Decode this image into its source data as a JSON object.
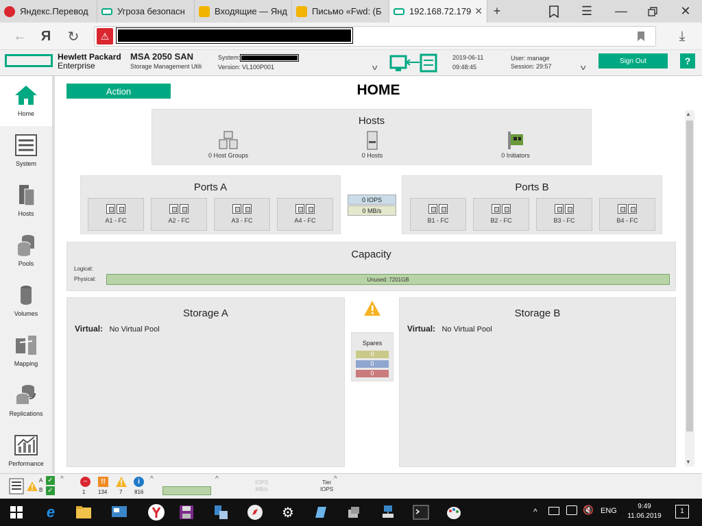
{
  "browser": {
    "tabs": [
      {
        "title": "Яндекс.Перевод",
        "favicon_color": "#d9262f"
      },
      {
        "title": "Угроза безопасн",
        "favicon_color": "#01a982"
      },
      {
        "title": "Входящие — Янд",
        "favicon_color": "#f2b400"
      },
      {
        "title": "Письмо «Fwd: (Б",
        "favicon_color": "#f2b400"
      },
      {
        "title": "192.168.72.179",
        "favicon_color": "#01a982",
        "active": true
      }
    ],
    "new_tab": "+",
    "yandex_letter": "Я"
  },
  "app": {
    "brand_line1": "Hewlett Packard",
    "brand_line2": "Enterprise",
    "product": "MSA 2050 SAN",
    "product_sub": "Storage Management Utili",
    "system_label": "System:",
    "version_label": "Version: VL100P001",
    "date": "2019-06-11",
    "time": "09:48:45",
    "user": "User: manage",
    "session": "Session: 29:57",
    "signout": "Sign Out",
    "help": "?",
    "accent": "#01a982"
  },
  "sidebar": {
    "items": [
      {
        "label": "Home"
      },
      {
        "label": "System"
      },
      {
        "label": "Hosts"
      },
      {
        "label": "Pools"
      },
      {
        "label": "Volumes"
      },
      {
        "label": "Mapping"
      },
      {
        "label": "Replications"
      },
      {
        "label": "Performance"
      }
    ]
  },
  "main": {
    "action": "Action",
    "title": "HOME",
    "hosts": {
      "title": "Hosts",
      "groups": "0 Host Groups",
      "hosts": "0 Hosts",
      "initiators": "0 Initiators"
    },
    "ports_a": {
      "title": "Ports A",
      "ports": [
        "A1 - FC",
        "A2 - FC",
        "A3 - FC",
        "A4 - FC"
      ]
    },
    "ports_b": {
      "title": "Ports B",
      "ports": [
        "B1 - FC",
        "B2 - FC",
        "B3 - FC",
        "B4 - FC"
      ]
    },
    "iops": "0 IOPS",
    "mbs": "0 MB/s",
    "capacity": {
      "title": "Capacity",
      "logical": "Logical:",
      "physical": "Physical:",
      "unused": "Unused: 7201GB"
    },
    "storage_a": {
      "title": "Storage A",
      "virtual_label": "Virtual:",
      "virtual_value": "No Virtual Pool"
    },
    "storage_b": {
      "title": "Storage B",
      "virtual_label": "Virtual:",
      "virtual_value": "No Virtual Pool"
    },
    "spares": {
      "title": "Spares",
      "values": [
        "0",
        "0",
        "0"
      ],
      "colors": [
        "#c9c98a",
        "#8fa6cf",
        "#c97a7a"
      ]
    }
  },
  "status": {
    "a_label": "A",
    "b_label": "B",
    "errors": "1",
    "critical": "134",
    "warnings": "7",
    "info": "816",
    "iops": "IOPS",
    "mbs": "MB/s",
    "tier": "Tier",
    "tier_iops": "IOPS"
  },
  "taskbar": {
    "lang": "ENG",
    "time": "9:49",
    "date": "11.06.2019",
    "notifications": "1"
  }
}
